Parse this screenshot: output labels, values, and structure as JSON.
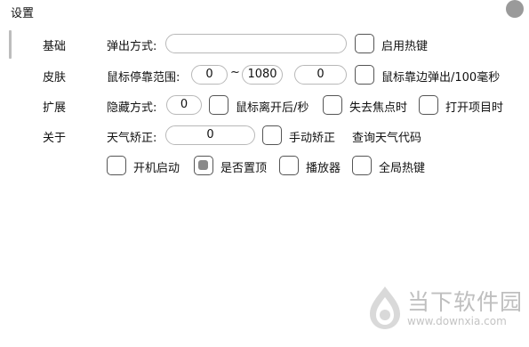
{
  "window": {
    "title": "设置"
  },
  "sidebar": {
    "items": [
      {
        "label": "基础"
      },
      {
        "label": "皮肤"
      },
      {
        "label": "扩展"
      },
      {
        "label": "关于"
      }
    ]
  },
  "settings": {
    "popup_mode_label": "弹出方式:",
    "popup_mode_value": "",
    "enable_hotkey_label": "启用热键",
    "mouse_range_label": "鼠标停靠范围:",
    "mouse_range_from": "0",
    "mouse_range_sep": "~",
    "mouse_range_to": "1080",
    "mouse_edge_value": "0",
    "mouse_edge_label": "鼠标靠边弹出/100毫秒",
    "hide_mode_label": "隐藏方式:",
    "hide_mode_value": "0",
    "mouse_leave_label": "鼠标离开后/秒",
    "lose_focus_label": "失去焦点时",
    "open_item_label": "打开项目时",
    "weather_correct_label": "天气矫正:",
    "weather_correct_value": "0",
    "manual_correct_label": "手动矫正",
    "query_weather_label": "查询天气代码",
    "startup_label": "开机启动",
    "pin_top_label": "是否置顶",
    "player_label": "播放器",
    "global_hotkey_label": "全局热键"
  },
  "watermark": {
    "name": "当下软件园",
    "url": "www.downxia.com"
  }
}
